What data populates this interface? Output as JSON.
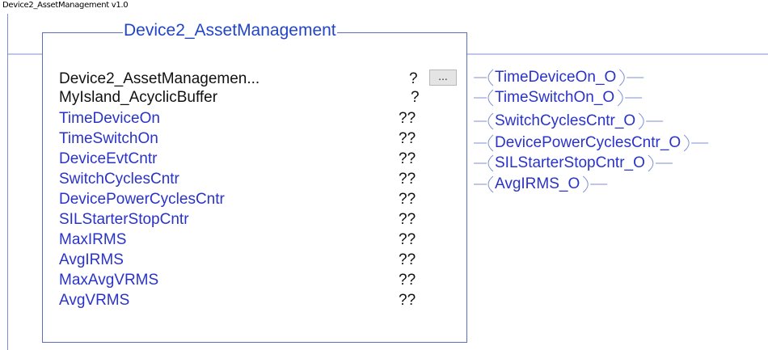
{
  "routine": {
    "caption": "Device2_AssetManagement v1.0"
  },
  "block": {
    "title": "Device2_AssetManagement",
    "ellipsis_label": "..."
  },
  "parameters": [
    {
      "name": "Device2_AssetManagemen...",
      "value": "?",
      "color": "#111111"
    },
    {
      "name": "MyIsland_AcyclicBuffer",
      "value": "?",
      "color": "#111111"
    },
    {
      "name": "TimeDeviceOn",
      "value": "??",
      "color": "#2a33c8"
    },
    {
      "name": "TimeSwitchOn",
      "value": "??",
      "color": "#2a33c8"
    },
    {
      "name": "DeviceEvtCntr",
      "value": "??",
      "color": "#2a33c8"
    },
    {
      "name": "SwitchCyclesCntr",
      "value": "??",
      "color": "#2a33c8"
    },
    {
      "name": "DevicePowerCyclesCntr",
      "value": "??",
      "color": "#2a33c8"
    },
    {
      "name": "SILStarterStopCntr",
      "value": "??",
      "color": "#2a33c8"
    },
    {
      "name": "MaxIRMS",
      "value": "??",
      "color": "#2a33c8"
    },
    {
      "name": "AvgIRMS",
      "value": "??",
      "color": "#2a33c8"
    },
    {
      "name": "MaxAvgVRMS",
      "value": "??",
      "color": "#2a33c8"
    },
    {
      "name": "AvgVRMS",
      "value": "??",
      "color": "#2a33c8"
    }
  ],
  "coils": [
    {
      "label": "TimeDeviceOn_O"
    },
    {
      "label": "TimeSwitchOn_O"
    },
    {
      "label": "SwitchCyclesCntr_O"
    },
    {
      "label": "DevicePowerCyclesCntr_O"
    },
    {
      "label": "SILStarterStopCntr_O"
    },
    {
      "label": "AvgIRMS_O"
    }
  ],
  "colors": {
    "wire": "#7d8fd6",
    "block_border": "#5a6fb8",
    "title": "#2245c8",
    "tag": "#2a33c8"
  }
}
